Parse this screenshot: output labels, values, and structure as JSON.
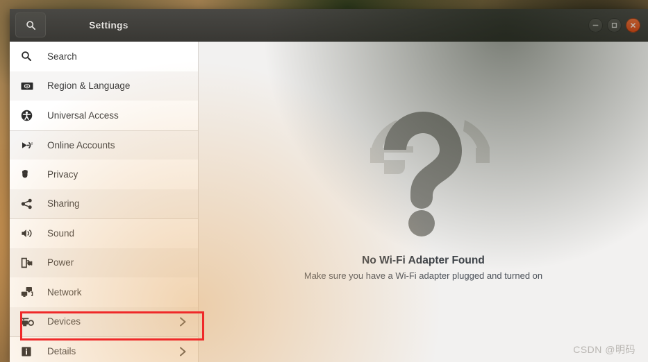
{
  "window": {
    "title": "Settings",
    "search_icon": "search-icon",
    "controls": [
      {
        "name": "minimize-button",
        "glyph": "minimize-icon",
        "color": "#514f4a"
      },
      {
        "name": "maximize-button",
        "glyph": "maximize-icon",
        "color": "#514f4a"
      },
      {
        "name": "close-button",
        "glyph": "close-icon",
        "color": "#dd4814"
      }
    ]
  },
  "sidebar": {
    "items": [
      {
        "label": "Search",
        "icon": "search-icon",
        "chevron": false,
        "separator_above": false,
        "selected": false
      },
      {
        "label": "Region & Language",
        "icon": "flag-icon",
        "chevron": false,
        "separator_above": false,
        "selected": false
      },
      {
        "label": "Universal Access",
        "icon": "accessibility-icon",
        "chevron": false,
        "separator_above": false,
        "selected": false
      },
      {
        "label": "Online Accounts",
        "icon": "plug-icon",
        "chevron": false,
        "separator_above": true,
        "selected": false
      },
      {
        "label": "Privacy",
        "icon": "hand-icon",
        "chevron": false,
        "separator_above": false,
        "selected": false
      },
      {
        "label": "Sharing",
        "icon": "share-icon",
        "chevron": false,
        "separator_above": false,
        "selected": false
      },
      {
        "label": "Sound",
        "icon": "speaker-icon",
        "chevron": false,
        "separator_above": true,
        "selected": false
      },
      {
        "label": "Power",
        "icon": "power-plug-icon",
        "chevron": false,
        "separator_above": false,
        "selected": false
      },
      {
        "label": "Network",
        "icon": "network-icon",
        "chevron": false,
        "separator_above": false,
        "selected": false
      },
      {
        "label": "Devices",
        "icon": "devices-icon",
        "chevron": true,
        "separator_above": false,
        "selected": true
      },
      {
        "label": "Details",
        "icon": "info-icon",
        "chevron": true,
        "separator_above": true,
        "selected": false
      }
    ]
  },
  "main": {
    "empty_state": {
      "icon": "question-mark-icon",
      "title": "No Wi-Fi Adapter Found",
      "subtitle": "Make sure you have a Wi-Fi adapter plugged and turned on"
    }
  },
  "annotation": {
    "target": "Devices",
    "color": "#ef2929"
  },
  "watermark": {
    "text": "CSDN @明码"
  }
}
